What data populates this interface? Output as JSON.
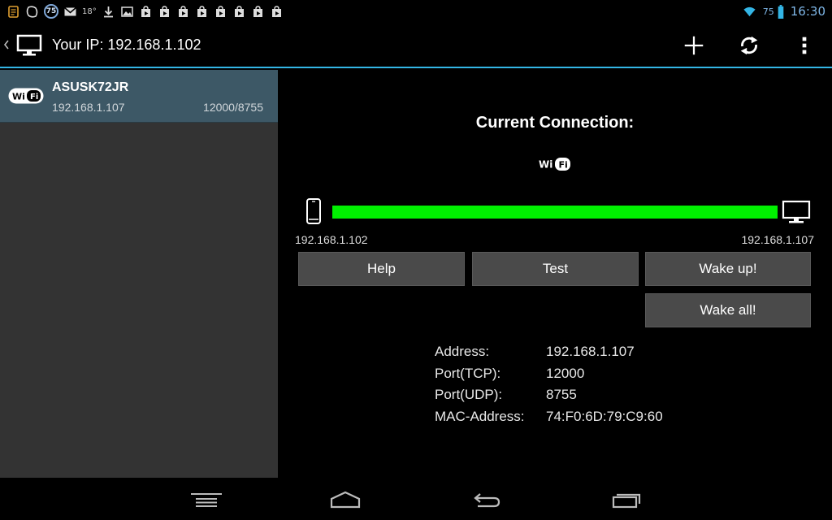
{
  "status_bar": {
    "weather_temp": "18°",
    "badge_count": "75",
    "battery_level": "75",
    "clock": "16:30"
  },
  "action_bar": {
    "title": "Your IP: 192.168.1.102",
    "icons": [
      "back-icon",
      "monitor-icon",
      "add-icon",
      "refresh-icon",
      "overflow-menu-icon"
    ]
  },
  "devices": [
    {
      "name": "ASUSK72JR",
      "ip": "192.168.1.107",
      "ports": "12000/8755",
      "selected": true
    }
  ],
  "connection": {
    "title": "Current Connection:",
    "local_ip": "192.168.1.102",
    "remote_ip": "192.168.1.107",
    "link_color": "#00f000"
  },
  "buttons": {
    "help": "Help",
    "test": "Test",
    "wake": "Wake up!",
    "wake_all": "Wake all!"
  },
  "details": {
    "address_label": "Address:",
    "address_value": "192.168.1.107",
    "tcp_label": "Port(TCP):",
    "tcp_value": "12000",
    "udp_label": "Port(UDP):",
    "udp_value": "8755",
    "mac_label": "MAC-Address:",
    "mac_value": "74:F0:6D:79:C9:60"
  },
  "colors": {
    "accent": "#33b5e5",
    "selected_item": "#3d5866",
    "left_pane": "#333333"
  }
}
